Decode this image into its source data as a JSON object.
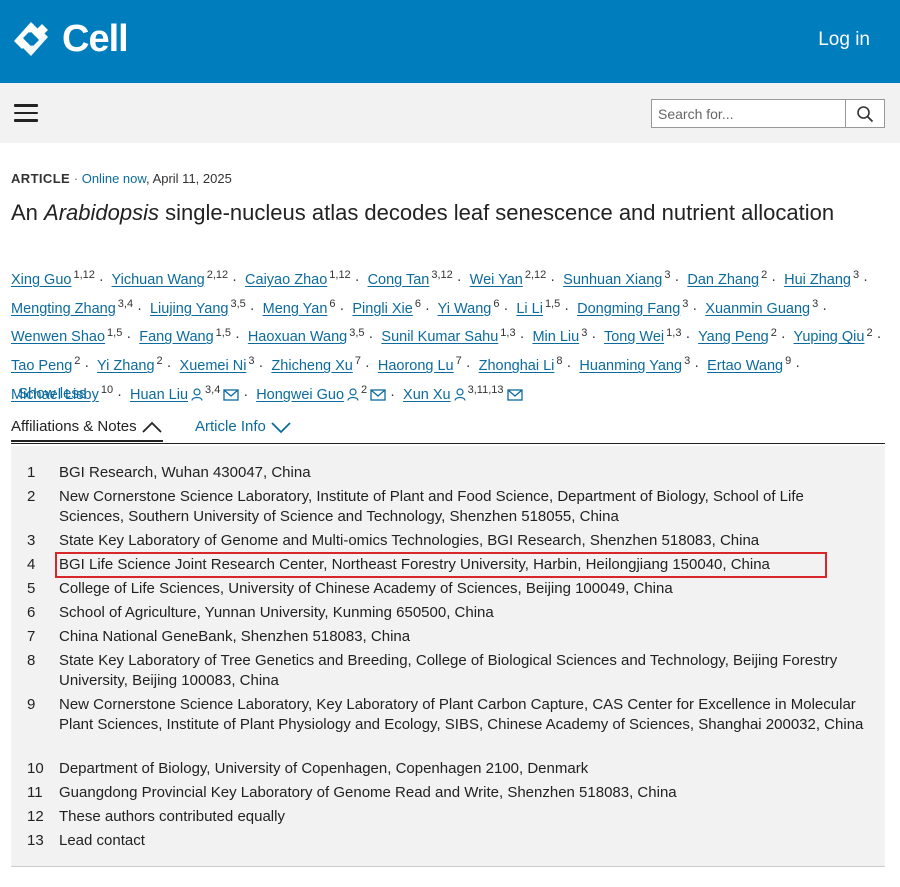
{
  "header": {
    "brand": "Cell",
    "login_label": "Log in",
    "search_placeholder": "Search for..."
  },
  "article": {
    "type": "ARTICLE",
    "status": "Online now",
    "date": "April 11, 2025",
    "title_prefix": "An ",
    "title_italic": "Arabidopsis",
    "title_suffix": " single-nucleus atlas decodes leaf senescence and nutrient allocation"
  },
  "authors": [
    {
      "name": "Xing Guo",
      "sup": "1,12"
    },
    {
      "name": "Yichuan Wang",
      "sup": "2,12"
    },
    {
      "name": "Caiyao Zhao",
      "sup": "1,12"
    },
    {
      "name": "Cong Tan",
      "sup": "3,12"
    },
    {
      "name": "Wei Yan",
      "sup": "2,12"
    },
    {
      "name": "Sunhuan Xiang",
      "sup": "3"
    },
    {
      "name": "Dan Zhang",
      "sup": "2"
    },
    {
      "name": "Hui Zhang",
      "sup": "3"
    },
    {
      "name": "Mengting Zhang",
      "sup": "3,4"
    },
    {
      "name": "Liujing Yang",
      "sup": "3,5"
    },
    {
      "name": "Meng Yan",
      "sup": "6"
    },
    {
      "name": "Pingli Xie",
      "sup": "6"
    },
    {
      "name": "Yi Wang",
      "sup": "6"
    },
    {
      "name": "Li Li",
      "sup": "1,5"
    },
    {
      "name": "Dongming Fang",
      "sup": "3"
    },
    {
      "name": "Xuanmin Guang",
      "sup": "3"
    },
    {
      "name": "Wenwen Shao",
      "sup": "1,5"
    },
    {
      "name": "Fang Wang",
      "sup": "1,5"
    },
    {
      "name": "Haoxuan Wang",
      "sup": "3,5"
    },
    {
      "name": "Sunil Kumar Sahu",
      "sup": "1,3"
    },
    {
      "name": "Min Liu",
      "sup": "3"
    },
    {
      "name": "Tong Wei",
      "sup": "1,3"
    },
    {
      "name": "Yang Peng",
      "sup": "2"
    },
    {
      "name": "Yuping Qiu",
      "sup": "2"
    },
    {
      "name": "Tao Peng",
      "sup": "2"
    },
    {
      "name": "Yi Zhang",
      "sup": "2"
    },
    {
      "name": "Xuemei Ni",
      "sup": "3"
    },
    {
      "name": "Zhicheng Xu",
      "sup": "7"
    },
    {
      "name": "Haorong Lu",
      "sup": "7"
    },
    {
      "name": "Zhonghai Li",
      "sup": "8"
    },
    {
      "name": "Huanming Yang",
      "sup": "3"
    },
    {
      "name": "Ertao Wang",
      "sup": "9"
    },
    {
      "name": "Michael Lisby",
      "sup": "10"
    },
    {
      "name": "Huan Liu",
      "sup": "3,4"
    },
    {
      "name": "Hongwei Guo",
      "sup": "2"
    },
    {
      "name": "Xun Xu",
      "sup": "3,11,13"
    }
  ],
  "show_less_label": "Show less",
  "tabs": {
    "affiliations_label": "Affiliations & Notes",
    "article_info_label": "Article Info"
  },
  "affiliations": [
    {
      "num": "1",
      "text": "BGI Research, Wuhan 430047, China"
    },
    {
      "num": "2",
      "text": "New Cornerstone Science Laboratory, Institute of Plant and Food Science, Department of Biology, School of Life Sciences, Southern University of Science and Technology, Shenzhen 518055, China"
    },
    {
      "num": "3",
      "text": "State Key Laboratory of Genome and Multi-omics Technologies, BGI Research, Shenzhen 518083, China"
    },
    {
      "num": "4",
      "text": "BGI Life Science Joint Research Center, Northeast Forestry University, Harbin, Heilongjiang 150040, China"
    },
    {
      "num": "5",
      "text": "College of Life Sciences, University of Chinese Academy of Sciences, Beijing 100049, China"
    },
    {
      "num": "6",
      "text": "School of Agriculture, Yunnan University, Kunming 650500, China"
    },
    {
      "num": "7",
      "text": "China National GeneBank, Shenzhen 518083, China"
    },
    {
      "num": "8",
      "text": "State Key Laboratory of Tree Genetics and Breeding, College of Biological Sciences and Technology, Beijing Forestry University, Beijing 100083, China"
    },
    {
      "num": "9",
      "text": "New Cornerstone Science Laboratory, Key Laboratory of Plant Carbon Capture, CAS Center for Excellence in Molecular Plant Sciences, Institute of Plant Physiology and Ecology, SIBS, Chinese Academy of Sciences, Shanghai 200032, China"
    },
    {
      "num": "10",
      "text": "Department of Biology, University of Copenhagen, Copenhagen 2100, Denmark"
    },
    {
      "num": "11",
      "text": "Guangdong Provincial Key Laboratory of Genome Read and Write, Shenzhen 518083, China"
    },
    {
      "num": "12",
      "text": "These authors contributed equally"
    },
    {
      "num": "13",
      "text": "Lead contact"
    }
  ],
  "colors": {
    "brand_blue": "#007dbc",
    "link_blue": "#0c6b9e",
    "highlight_red": "#d9262b",
    "panel_gray": "#f2f2f2"
  }
}
